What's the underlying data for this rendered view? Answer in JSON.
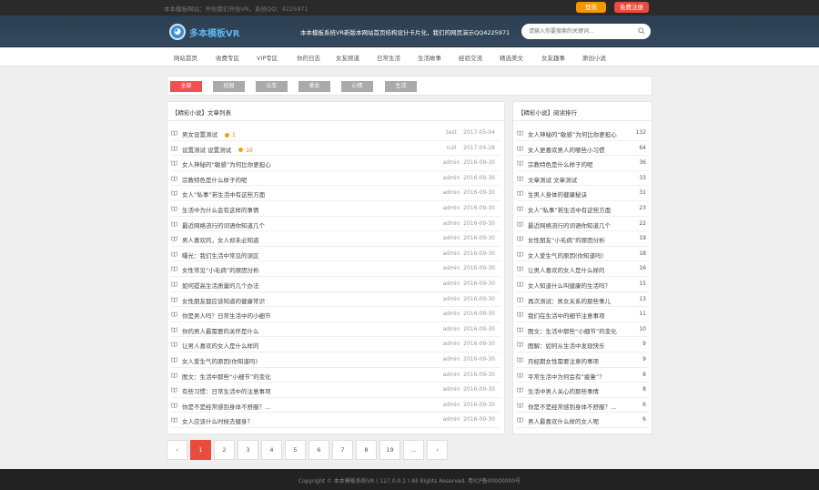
{
  "topbar": {
    "notice": "本本模板网站：开始我们开始VR，系统QQ：4225971",
    "btn_login": "登陆",
    "btn_register": "免费注册",
    "accent_login": "#f39800",
    "accent_register": "#e84c3d"
  },
  "header": {
    "logo_text": "多本模板VR",
    "slogan": "本本模板系统VR新版本网站首页结构设计卡片化，我们的网页演示QQ4225971",
    "search_placeholder": "请输入你要搜索的关键词..."
  },
  "nav": {
    "items": [
      "网站首页",
      "收费专区",
      "VIP专区",
      "你的日志",
      "女友频道",
      "日常生活",
      "生活故事",
      "经验交流",
      "精选美文",
      "女友趣事",
      "原创小说"
    ]
  },
  "filter": {
    "chips": [
      "全部",
      "校园",
      "公车",
      "美女",
      "心情",
      "生活"
    ],
    "active_color": "#f05050"
  },
  "list": {
    "title": "【精彩小说】文章列表",
    "rows": [
      {
        "title": "男女设置测试",
        "coin": "1",
        "author": "test",
        "date": "2017-05-04"
      },
      {
        "title": "设置测试 设置测试",
        "coin": "10",
        "author": "null",
        "date": "2017-04-28"
      },
      {
        "title": "女人神秘的“敏感”为何比你更担心",
        "coin": "",
        "author": "admin",
        "date": "2016-09-30"
      },
      {
        "title": "宗教特色是什么样子的呢",
        "coin": "",
        "author": "admin",
        "date": "2016-09-30"
      },
      {
        "title": "女人“私事”若生活中有这些方面",
        "coin": "",
        "author": "admin",
        "date": "2016-09-30"
      },
      {
        "title": "生活中为什么会有这样的事情",
        "coin": "",
        "author": "admin",
        "date": "2016-09-30"
      },
      {
        "title": "最近网络流行的词语你知道几个",
        "coin": "",
        "author": "admin",
        "date": "2016-09-30"
      },
      {
        "title": "男人喜欢的，女人却未必知道",
        "coin": "",
        "author": "admin",
        "date": "2016-09-30"
      },
      {
        "title": "曝光：我们生活中常见的误区",
        "coin": "",
        "author": "admin",
        "date": "2016-09-30"
      },
      {
        "title": "女性常见“小毛病”的原因分析",
        "coin": "",
        "author": "admin",
        "date": "2016-09-30"
      },
      {
        "title": "如何提高生活质量的几个办法",
        "coin": "",
        "author": "admin",
        "date": "2016-09-30"
      },
      {
        "title": "女性朋友都应该知道的健康常识",
        "coin": "",
        "author": "admin",
        "date": "2016-09-30"
      },
      {
        "title": "你是男人吗？日常生活中的小细节",
        "coin": "",
        "author": "admin",
        "date": "2016-09-30"
      },
      {
        "title": "你的男人最需要的关怀是什么",
        "coin": "",
        "author": "admin",
        "date": "2016-09-30"
      },
      {
        "title": "让男人喜欢的女人是什么样的",
        "coin": "",
        "author": "admin",
        "date": "2016-09-30"
      },
      {
        "title": "女人爱生气的原因(你知道吗)",
        "coin": "",
        "author": "admin",
        "date": "2016-09-30"
      },
      {
        "title": "图文：生活中那些“小细节”的变化",
        "coin": "",
        "author": "admin",
        "date": "2016-09-30"
      },
      {
        "title": "有些习惯：日常生活中的注意事项",
        "coin": "",
        "author": "admin",
        "date": "2016-09-30"
      },
      {
        "title": "你是不是经常感到身体不舒服？...",
        "coin": "",
        "author": "admin",
        "date": "2016-09-30"
      },
      {
        "title": "女人应该什么时候去健身？",
        "coin": "",
        "author": "admin",
        "date": "2016-09-30"
      }
    ]
  },
  "rank": {
    "title": "【精彩小说】阅读排行",
    "rows": [
      {
        "title": "女人神秘的“敏感”为何比你更担心",
        "count": "132"
      },
      {
        "title": "女人更喜欢男人的哪些小习惯",
        "count": "64"
      },
      {
        "title": "宗教特色是什么样子的呢",
        "count": "36"
      },
      {
        "title": "文章测试 文章测试",
        "count": "33"
      },
      {
        "title": "生男人身体的健康秘诀",
        "count": "31"
      },
      {
        "title": "女人“私事”若生活中有这些方面",
        "count": "23"
      },
      {
        "title": "最近网络流行的词语你知道几个",
        "count": "22"
      },
      {
        "title": "女性朋友“小毛病”的原因分析",
        "count": "19"
      },
      {
        "title": "女人爱生气的原因(你知道吗)",
        "count": "18"
      },
      {
        "title": "让男人喜欢的女人是什么样的",
        "count": "16"
      },
      {
        "title": "女人知道什么叫健康的生活吗？",
        "count": "15"
      },
      {
        "title": "再次测试：男女关系的那些事儿",
        "count": "13"
      },
      {
        "title": "我们在生活中的细节注意事项",
        "count": "11"
      },
      {
        "title": "图文：生活中那些“小细节”的变化",
        "count": "10"
      },
      {
        "title": "图解：如何从生活中发现快乐",
        "count": "9"
      },
      {
        "title": "月经期女性需要注意的事项",
        "count": "9"
      },
      {
        "title": "平常生活中为何会有“疲惫”？",
        "count": "8"
      },
      {
        "title": "生活中男人关心的那些事情",
        "count": "8"
      },
      {
        "title": "你是不是经常感到身体不舒服？...",
        "count": "6"
      },
      {
        "title": "男人最喜欢什么样的女人呢",
        "count": "6"
      }
    ]
  },
  "pager": {
    "items": [
      "‹",
      "1",
      "2",
      "3",
      "4",
      "5",
      "6",
      "7",
      "8",
      "19",
      "...",
      "›"
    ],
    "active": "1"
  },
  "footer": {
    "copyright": "Copyright © 本本模板系统VR ( 127.0.0.1 ) All Rights Reserved. 粤ICP备00000000号"
  }
}
